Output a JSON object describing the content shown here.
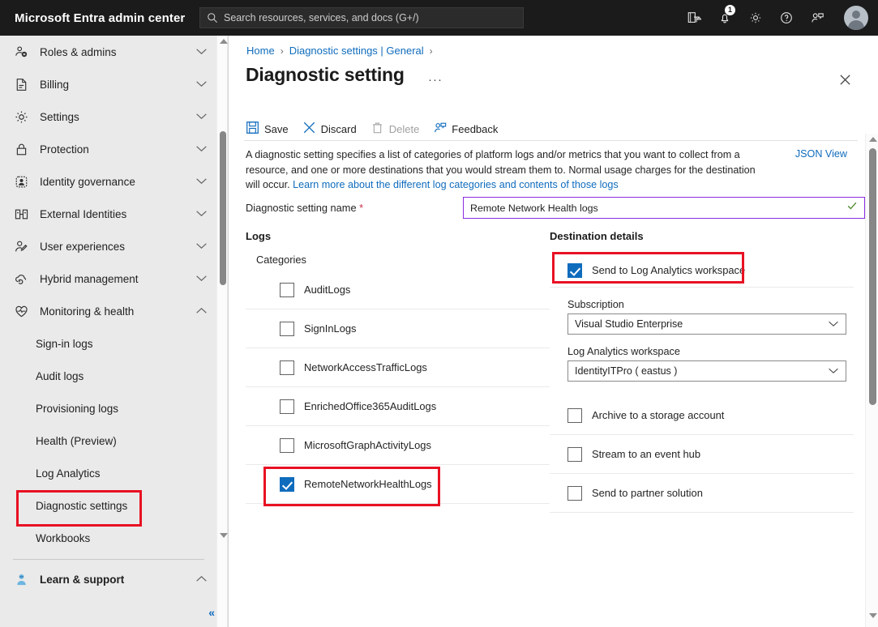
{
  "topbar": {
    "brand": "Microsoft Entra admin center",
    "search_placeholder": "Search resources, services, and docs (G+/)",
    "notification_count": "1",
    "icons": [
      "directory-switch-icon",
      "notifications-bell-icon",
      "gear-icon",
      "help-icon",
      "feedback-person-icon",
      "account-avatar"
    ]
  },
  "sidebar": {
    "items": [
      {
        "label": "Roles & admins",
        "icon": "roles-admins-icon",
        "chevron": "down"
      },
      {
        "label": "Billing",
        "icon": "billing-document-icon",
        "chevron": "down"
      },
      {
        "label": "Settings",
        "icon": "gear-icon",
        "chevron": "down"
      },
      {
        "label": "Protection",
        "icon": "lock-icon",
        "chevron": "down"
      },
      {
        "label": "Identity governance",
        "icon": "identity-governance-icon",
        "chevron": "down"
      },
      {
        "label": "External Identities",
        "icon": "external-identities-icon",
        "chevron": "down"
      },
      {
        "label": "User experiences",
        "icon": "user-pencil-icon",
        "chevron": "down"
      },
      {
        "label": "Hybrid management",
        "icon": "cloud-sync-icon",
        "chevron": "down"
      },
      {
        "label": "Monitoring & health",
        "icon": "heart-pulse-icon",
        "chevron": "up"
      }
    ],
    "subitems": [
      {
        "label": "Sign-in logs"
      },
      {
        "label": "Audit logs"
      },
      {
        "label": "Provisioning logs"
      },
      {
        "label": "Health (Preview)"
      },
      {
        "label": "Log Analytics"
      },
      {
        "label": "Diagnostic settings",
        "highlighted": true
      },
      {
        "label": "Workbooks"
      }
    ],
    "learn_support": {
      "label": "Learn & support",
      "icon": "support-person-icon",
      "chevron": "up"
    },
    "collapse_label": "«"
  },
  "breadcrumb": {
    "items": [
      {
        "label": "Home",
        "link": true
      },
      {
        "label": "Diagnostic settings | General",
        "link": true
      }
    ],
    "separator": "›"
  },
  "page": {
    "title": "Diagnostic setting",
    "more_dots": "···",
    "close_icon": "close-icon"
  },
  "toolbar": {
    "save": "Save",
    "discard": "Discard",
    "delete": "Delete",
    "feedback": "Feedback"
  },
  "description": {
    "text_1": "A diagnostic setting specifies a list of categories of platform logs and/or metrics that you want to collect from a resource, and one or more destinations that you would stream them to. Normal usage charges for the destination will occur. ",
    "link": "Learn more about the different log categories and contents of those logs",
    "json_view": "JSON View"
  },
  "name_field": {
    "label": "Diagnostic setting name ",
    "required_mark": "*",
    "value": "Remote Network Health logs",
    "valid_icon": "green-check-icon",
    "border_color": "#8a2be2"
  },
  "logs": {
    "section_title": "Logs",
    "categories_label": "Categories",
    "items": [
      {
        "label": "AuditLogs",
        "checked": false
      },
      {
        "label": "SignInLogs",
        "checked": false
      },
      {
        "label": "NetworkAccessTrafficLogs",
        "checked": false
      },
      {
        "label": "EnrichedOffice365AuditLogs",
        "checked": false
      },
      {
        "label": "MicrosoftGraphActivityLogs",
        "checked": false
      },
      {
        "label": "RemoteNetworkHealthLogs",
        "checked": true,
        "highlighted": true
      }
    ]
  },
  "destination": {
    "section_title": "Destination details",
    "send_log_analytics": {
      "label": "Send to Log Analytics workspace",
      "checked": true,
      "highlighted": true
    },
    "subscription_label": "Subscription",
    "subscription_value": "Visual Studio Enterprise",
    "workspace_label": "Log Analytics workspace",
    "workspace_value": "IdentityITPro ( eastus )",
    "options": [
      {
        "label": "Archive to a storage account",
        "checked": false
      },
      {
        "label": "Stream to an event hub",
        "checked": false
      },
      {
        "label": "Send to partner solution",
        "checked": false
      }
    ]
  },
  "colors": {
    "accent_blue": "#0f6cbd",
    "annotation_red": "#e81123",
    "topbar_bg": "#1b1b1b",
    "sidebar_bg": "#eaeaea",
    "checkbox_checked": "#0f6cbd"
  }
}
